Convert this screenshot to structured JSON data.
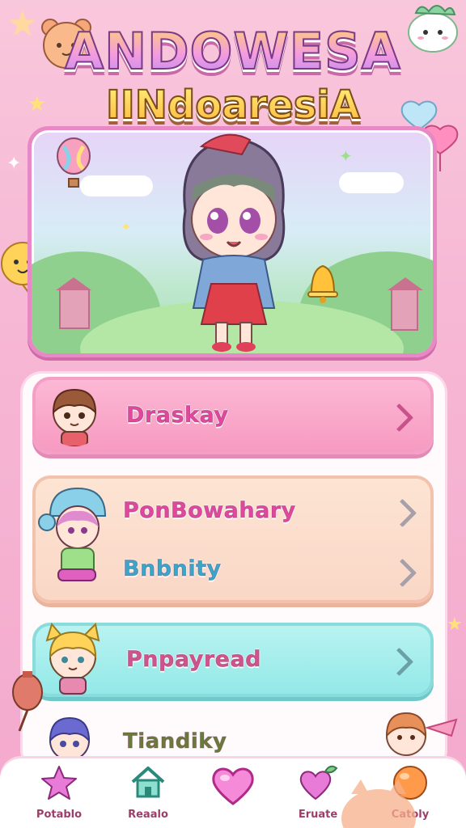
{
  "title": {
    "main": "ANDOWESA",
    "sub": "IINdoaresiA"
  },
  "menu": {
    "item1": "Draskay",
    "item2a": "PonBowahary",
    "item2b": "Bnbnity",
    "item3": "Pnpayread",
    "item4": "Tiandiky"
  },
  "nav": {
    "items": [
      {
        "label": "Potablo",
        "icon": "star-icon"
      },
      {
        "label": "Reaalo",
        "icon": "home-icon"
      },
      {
        "label": "",
        "icon": "heart-icon"
      },
      {
        "label": "Eruate",
        "icon": "heart-plant-icon"
      },
      {
        "label": "Catoly",
        "icon": "orange-ball-icon"
      }
    ]
  },
  "colors": {
    "background": "#f6b7d4",
    "pink_button": "#f79ac1",
    "peach_button": "#fad7c6",
    "cyan_button": "#93e9e8",
    "label_pink": "#e0489c",
    "label_cyan": "#3aa6c8",
    "label_brown": "#c8528a"
  }
}
